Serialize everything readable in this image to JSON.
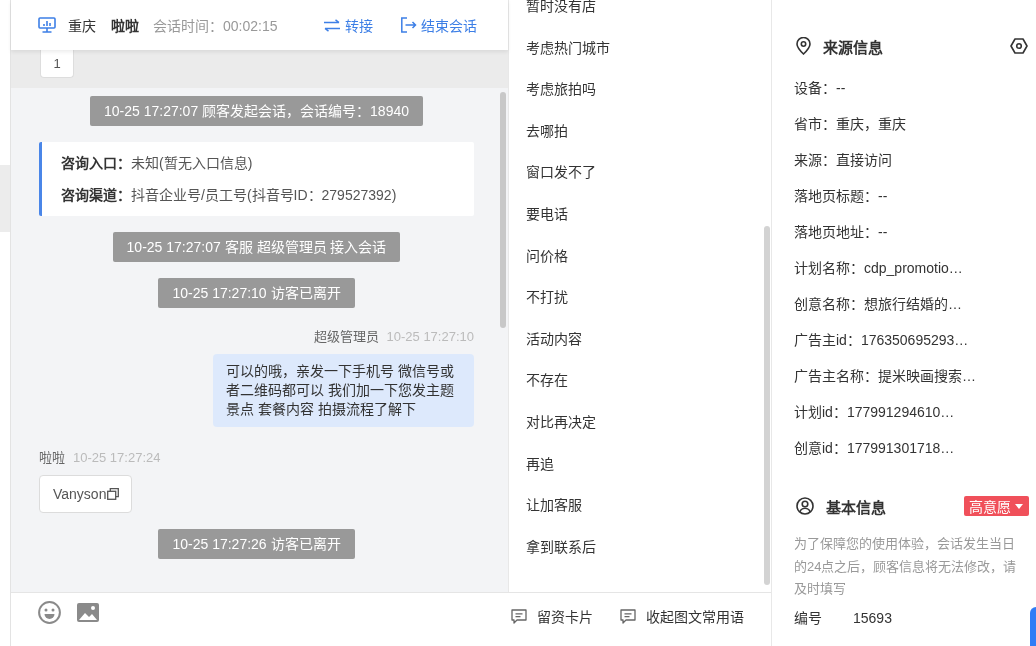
{
  "header": {
    "city": "重庆",
    "visitor": "啦啦",
    "session_time": "会话时间：00:02:15",
    "actions": [
      {
        "kind": "transfer",
        "label": "转接"
      },
      {
        "kind": "end",
        "label": "结束会话"
      }
    ]
  },
  "pinned": {
    "text": "1"
  },
  "messages": [
    {
      "kind": "notice",
      "text": "10-25 17:27:07 顾客发起会话，会话编号：18940"
    },
    {
      "kind": "info",
      "rows": [
        {
          "label": "咨询入口：",
          "value": "未知(暂无入口信息)"
        },
        {
          "label": "咨询渠道：",
          "value": "抖音企业号/员工号(抖音号ID：279527392)"
        }
      ]
    },
    {
      "kind": "notice",
      "text": "10-25 17:27:07 客服 超级管理员 接入会话"
    },
    {
      "kind": "notice",
      "text": "10-25 17:27:10 访客已离开"
    },
    {
      "kind": "agent",
      "sender": "超级管理员",
      "time": "10-25 17:27:10",
      "text": "可以的哦，亲发一下手机号 微信号或者二维码都可以 我们加一下您发主题景点 套餐内容 拍摄流程了解下"
    },
    {
      "kind": "visitor",
      "sender": "啦啦",
      "time": "10-25 17:27:24",
      "text": "Vanyson"
    },
    {
      "kind": "notice",
      "text": "10-25 17:27:26 访客已离开"
    }
  ],
  "quick_replies": [
    "暂时没有店",
    "考虑热门城市",
    "考虑旅拍吗",
    "去哪拍",
    "窗口发不了",
    "要电话",
    "问价格",
    "不打扰",
    "活动内容",
    "不存在",
    "对比再决定",
    "再追",
    "让加客服",
    "拿到联系后"
  ],
  "toolbar": {
    "actions": [
      {
        "label": "留资卡片"
      },
      {
        "label": "收起图文常用语"
      }
    ]
  },
  "source_info": {
    "title": "来源信息",
    "lines": [
      "设备：--",
      "省市：重庆，重庆",
      "来源：直接访问",
      "落地页标题：--",
      "落地页地址：--",
      "计划名称：cdp_promotio…",
      "创意名称：想旅行结婚的…",
      "广告主id：176350695293…",
      "广告主名称：提米映画搜索…",
      "计划id：177991294610…",
      "创意id：177991301718…"
    ]
  },
  "basic_info": {
    "title": "基本信息",
    "intent": "高意愿",
    "notice": "为了保障您的使用体验，会话发生当日的24点之后，顾客信息将无法修改，请及时填写",
    "fields": [
      {
        "label": "编号",
        "value": "15693"
      }
    ]
  }
}
